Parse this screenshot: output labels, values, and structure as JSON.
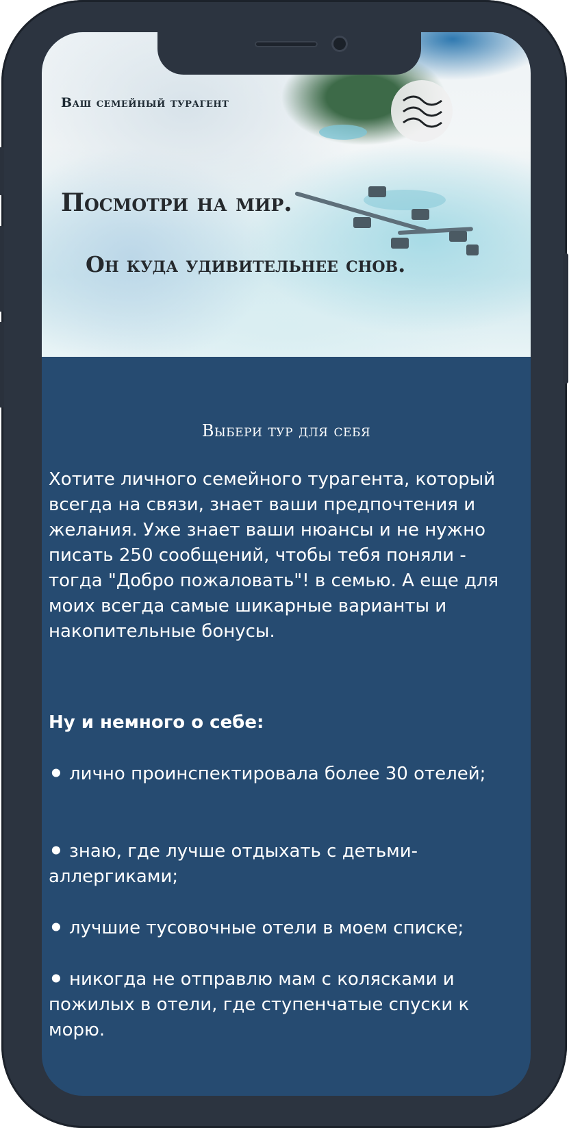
{
  "header": {
    "brand": "Ваш семейный турагент",
    "menu_icon": "waves-menu-icon"
  },
  "hero": {
    "line1": "Посмотри на мир.",
    "line2": "Он куда удивительнее снов."
  },
  "content": {
    "title": "Выбери тур для себя",
    "intro": "Хотите личного семейного турагента, который всегда на связи, знает ваши предпочтения и желания. Уже знает ваши нюансы и не нужно писать 250 сообщений, чтобы тебя поняли - тогда \"Добро пожаловать\"! в семью. А еще для моих всегда самые шикарные варианты и накопительные бонусы.",
    "about_heading": "Ну и немного о себе:",
    "bullets": [
      "⚫ лично проинспектировала более 30 отелей;",
      "⚫ знаю, где лучше отдыхать с детьми-аллергиками;",
      "⚫ лучшие тусовочные отели  в моем списке;",
      "⚫ никогда не отправлю мам с колясками и пожилых в отели, где ступенчатые спуски к морю."
    ]
  },
  "colors": {
    "frame": "#2c3440",
    "content_bg": "#264b71",
    "text": "#ffffff"
  }
}
